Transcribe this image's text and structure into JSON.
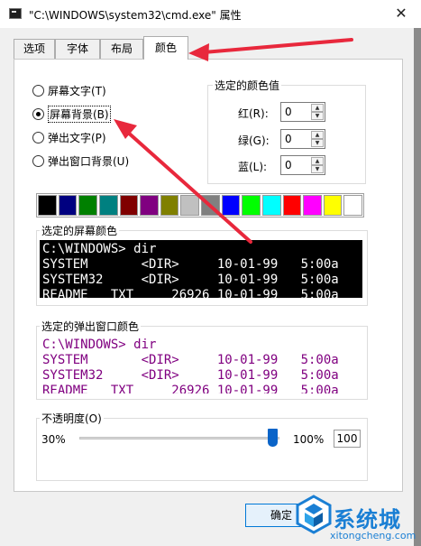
{
  "window": {
    "title": "\"C:\\WINDOWS\\system32\\cmd.exe\" 属性",
    "close_icon": "close-icon"
  },
  "tabs": [
    {
      "label": "选项",
      "active": false
    },
    {
      "label": "字体",
      "active": false
    },
    {
      "label": "布局",
      "active": false
    },
    {
      "label": "颜色",
      "active": true
    }
  ],
  "radios": [
    {
      "label": "屏幕文字(T)",
      "checked": false
    },
    {
      "label": "屏幕背景(B)",
      "checked": true
    },
    {
      "label": "弹出文字(P)",
      "checked": false
    },
    {
      "label": "弹出窗口背景(U)",
      "checked": false
    }
  ],
  "color_values": {
    "label": "选定的颜色值",
    "red": {
      "label": "红(R):",
      "value": "0"
    },
    "green": {
      "label": "绿(G):",
      "value": "0"
    },
    "blue": {
      "label": "蓝(L):",
      "value": "0"
    }
  },
  "palette": [
    "#000000",
    "#000080",
    "#008000",
    "#008080",
    "#800000",
    "#800080",
    "#808000",
    "#c0c0c0",
    "#808080",
    "#0000ff",
    "#00ff00",
    "#00ffff",
    "#ff0000",
    "#ff00ff",
    "#ffff00",
    "#ffffff"
  ],
  "screen_preview": {
    "label": "选定的屏幕颜色",
    "bg": "#000000",
    "fg": "#ffffff",
    "lines": [
      "C:\\WINDOWS> dir",
      "SYSTEM       <DIR>     10-01-99   5:00a",
      "SYSTEM32     <DIR>     10-01-99   5:00a",
      "README   TXT     26926 10-01-99   5:00a"
    ]
  },
  "popup_preview": {
    "label": "选定的弹出窗口颜色",
    "bg": "#ffffff",
    "fg": "#800080",
    "lines": [
      "C:\\WINDOWS> dir",
      "SYSTEM       <DIR>     10-01-99   5:00a",
      "SYSTEM32     <DIR>     10-01-99   5:00a",
      "README   TXT     26926 10-01-99   5:00a"
    ]
  },
  "opacity": {
    "label": "不透明度(O)",
    "min_label": "30%",
    "max_label": "100%",
    "value": "100",
    "level": 1.0
  },
  "buttons": {
    "ok": "确定"
  },
  "watermark": {
    "brand": "系统城",
    "url": "xitongcheng.com"
  },
  "annotation_color": "#e8283c"
}
